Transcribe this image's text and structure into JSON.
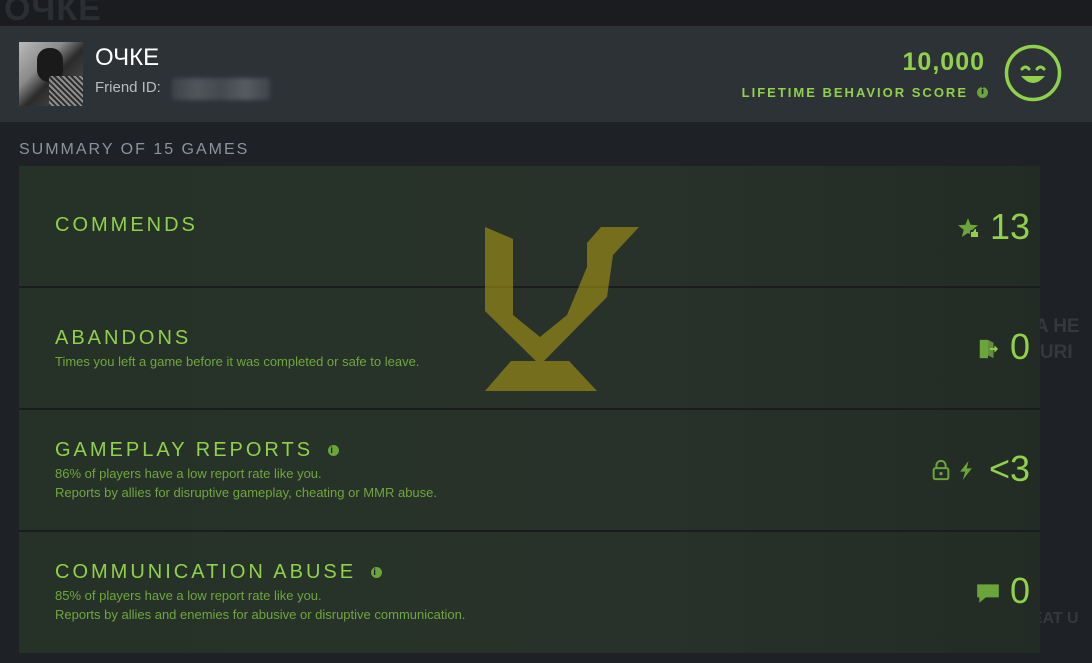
{
  "profile": {
    "username": "ОЧКЕ",
    "friend_id_label": "Friend ID:"
  },
  "behavior": {
    "score": "10,000",
    "label": "LIFETIME BEHAVIOR SCORE"
  },
  "summary": {
    "title": "SUMMARY OF 15 GAMES"
  },
  "rows": [
    {
      "title": "COMMENDS",
      "desc1": "",
      "desc2": "",
      "value": "13",
      "icon": "star-thumb-icon"
    },
    {
      "title": "ABANDONS",
      "desc1": "Times you left a game before it was completed or safe to leave.",
      "desc2": "",
      "value": "0",
      "icon": "door-exit-icon"
    },
    {
      "title": "GAMEPLAY REPORTS",
      "desc1": "86% of players have a low report rate like you.",
      "desc2": "Reports by allies for disruptive gameplay, cheating or MMR abuse.",
      "value": "<3",
      "icon": "lock-lightning-icon"
    },
    {
      "title": "COMMUNICATION ABUSE",
      "desc1": "85% of players have a low report rate like you.",
      "desc2": "Reports by allies and enemies for abusive or disruptive communication.",
      "value": "0",
      "icon": "chat-bubble-icon"
    }
  ],
  "background_text": {
    "top_left": "ОЧКЕ",
    "right1": "CHOOSE A HE",
    "right2": "ATURI",
    "right3": "FEAT U"
  },
  "colors": {
    "accent": "#8fd14a",
    "header_bg": "#2d3237",
    "panel_bg": "#263227",
    "page_bg": "#1e2125"
  }
}
